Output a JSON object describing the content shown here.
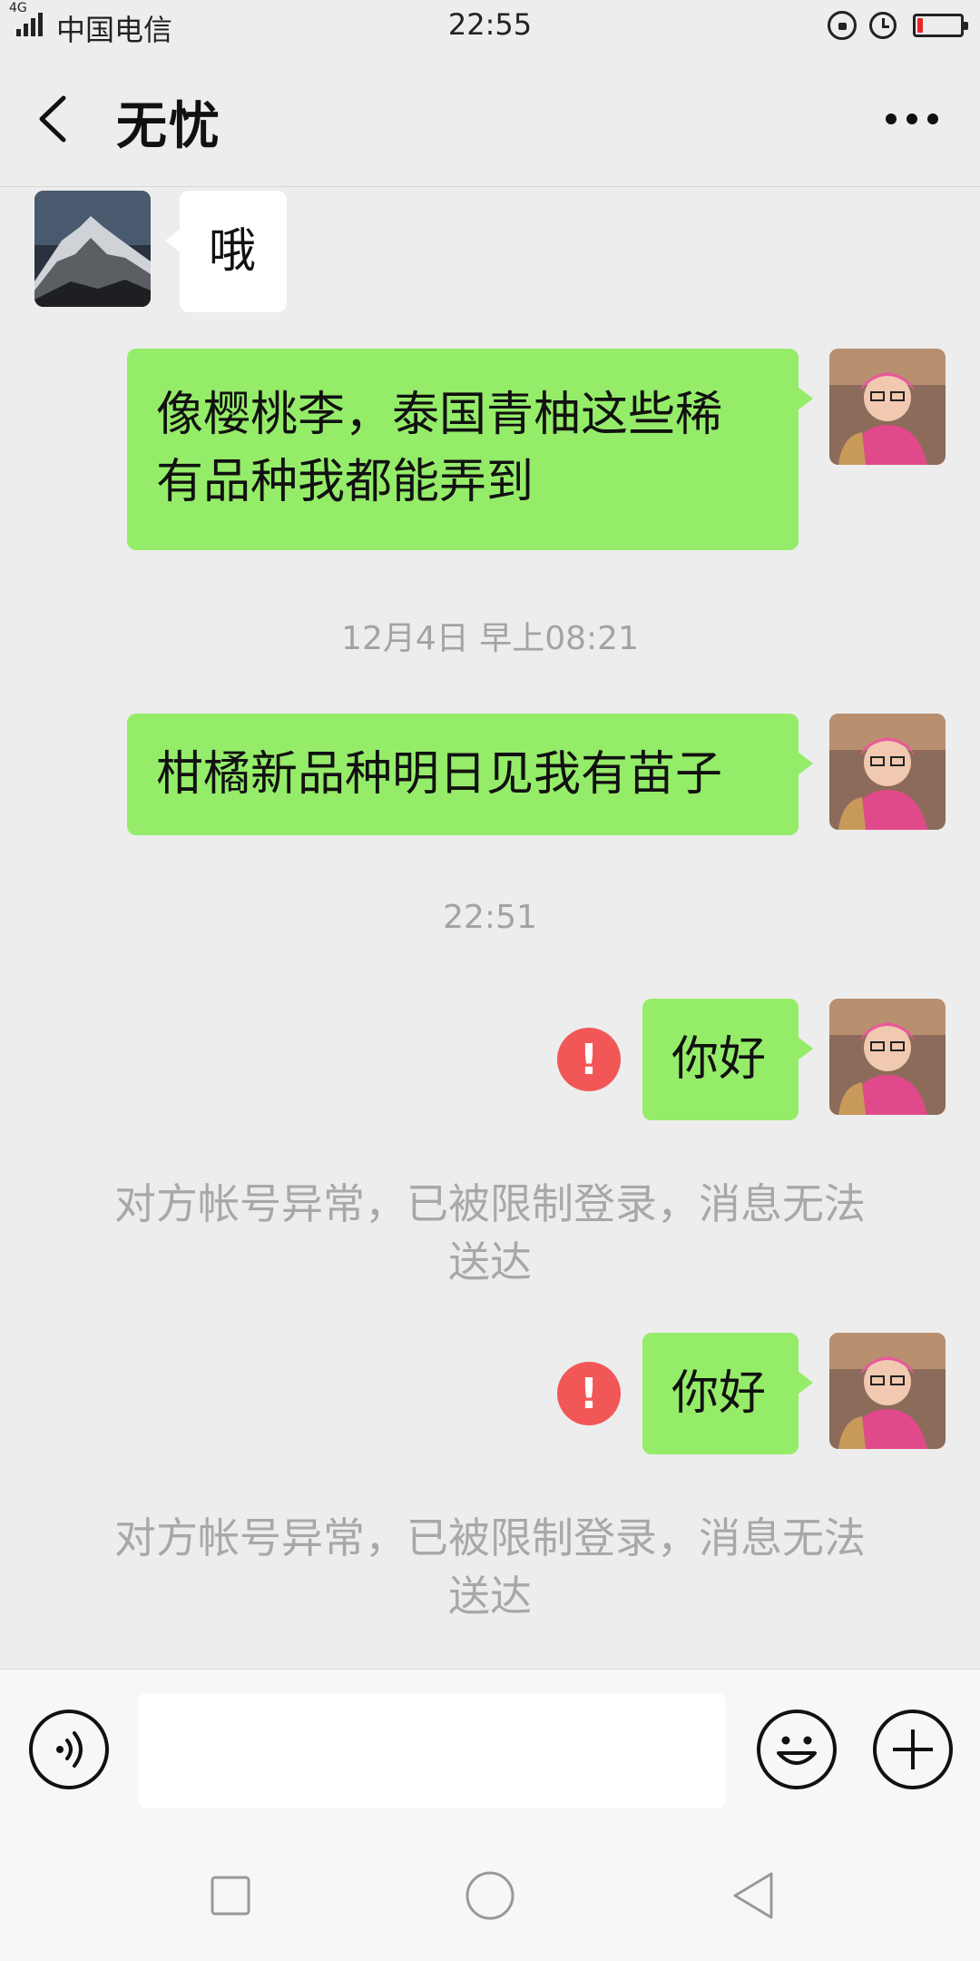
{
  "status_bar": {
    "network": "4G",
    "carrier": "中国电信",
    "time": "22:55",
    "battery_level": 0.12,
    "battery_color": "#e8262a"
  },
  "header": {
    "back_icon": "chevron-left-icon",
    "title": "无忧",
    "more_icon": "more-dots-icon"
  },
  "messages": [
    {
      "type": "incoming",
      "text": "哦",
      "avatar": "mountain-avatar"
    },
    {
      "type": "outgoing",
      "lines": [
        "像樱桃李，泰国青柚这些稀",
        "有品种我都能弄到"
      ],
      "avatar": "user-avatar"
    },
    {
      "type": "time",
      "text": "12月4日 早上08:21"
    },
    {
      "type": "outgoing",
      "text": "柑橘新品种明日见我有苗子",
      "avatar": "user-avatar"
    },
    {
      "type": "time",
      "text": "22:51"
    },
    {
      "type": "outgoing",
      "text": "你好",
      "failed": true,
      "avatar": "user-avatar"
    },
    {
      "type": "system",
      "lines": [
        "对方帐号异常，已被限制登录，消息无法",
        "送达"
      ]
    },
    {
      "type": "outgoing",
      "text": "你好",
      "failed": true,
      "avatar": "user-avatar"
    },
    {
      "type": "system",
      "lines": [
        "对方帐号异常，已被限制登录，消息无法",
        "送达"
      ]
    }
  ],
  "error_mark": "!",
  "input_bar": {
    "voice_icon": "voice-icon",
    "input_value": "",
    "emoji_icon": "emoji-icon",
    "plus_icon": "plus-icon"
  },
  "colors": {
    "outgoing_bubble": "#95ec69",
    "incoming_bubble": "#ffffff",
    "background": "#ededed",
    "error": "#f25757"
  }
}
